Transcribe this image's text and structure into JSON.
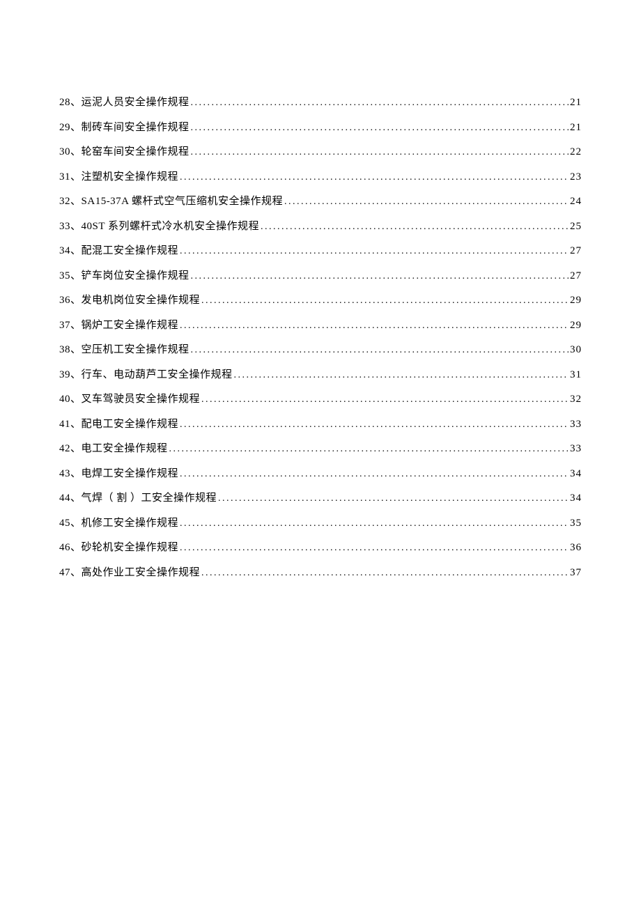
{
  "toc": {
    "entries": [
      {
        "number": "28、",
        "title": "运泥人员安全操作规程",
        "page": "21"
      },
      {
        "number": "29、",
        "title": "制砖车间安全操作规程",
        "page": "21"
      },
      {
        "number": "30、",
        "title": "轮窑车间安全操作规程",
        "page": "22"
      },
      {
        "number": "31、",
        "title": "注塑机安全操作规程",
        "page": "23"
      },
      {
        "number": "32、",
        "title": "SA15-37A 螺杆式空气压缩机安全操作规程 ",
        "page": "24"
      },
      {
        "number": "33、",
        "title": "40ST 系列螺杆式冷水机安全操作规程 ",
        "page": "25"
      },
      {
        "number": "34、",
        "title": "配混工安全操作规程",
        "page": "27"
      },
      {
        "number": "35、",
        "title": "铲车岗位安全操作规程",
        "page": "27"
      },
      {
        "number": "36、",
        "title": "发电机岗位安全操作规程",
        "page": "29"
      },
      {
        "number": "37、",
        "title": "锅炉工安全操作规程",
        "page": "29"
      },
      {
        "number": "38、",
        "title": "空压机工安全操作规程",
        "page": "30"
      },
      {
        "number": "39、",
        "title": "行车、电动葫芦工安全操作规程",
        "page": "31"
      },
      {
        "number": "40、",
        "title": "叉车驾驶员安全操作规程",
        "page": "32"
      },
      {
        "number": "41、",
        "title": "配电工安全操作规程",
        "page": "33"
      },
      {
        "number": "42、",
        "title": "电工安全操作规程",
        "page": "33"
      },
      {
        "number": "43、",
        "title": "电焊工安全操作规程",
        "page": "34"
      },
      {
        "number": "44、",
        "title": "气焊（ 割 ）工安全操作规程",
        "page": "34"
      },
      {
        "number": "45、",
        "title": "机修工安全操作规程",
        "page": "35"
      },
      {
        "number": "46、",
        "title": "砂轮机安全操作规程",
        "page": "36"
      },
      {
        "number": "47、",
        "title": "高处作业工安全操作规程",
        "page": "37"
      }
    ]
  }
}
